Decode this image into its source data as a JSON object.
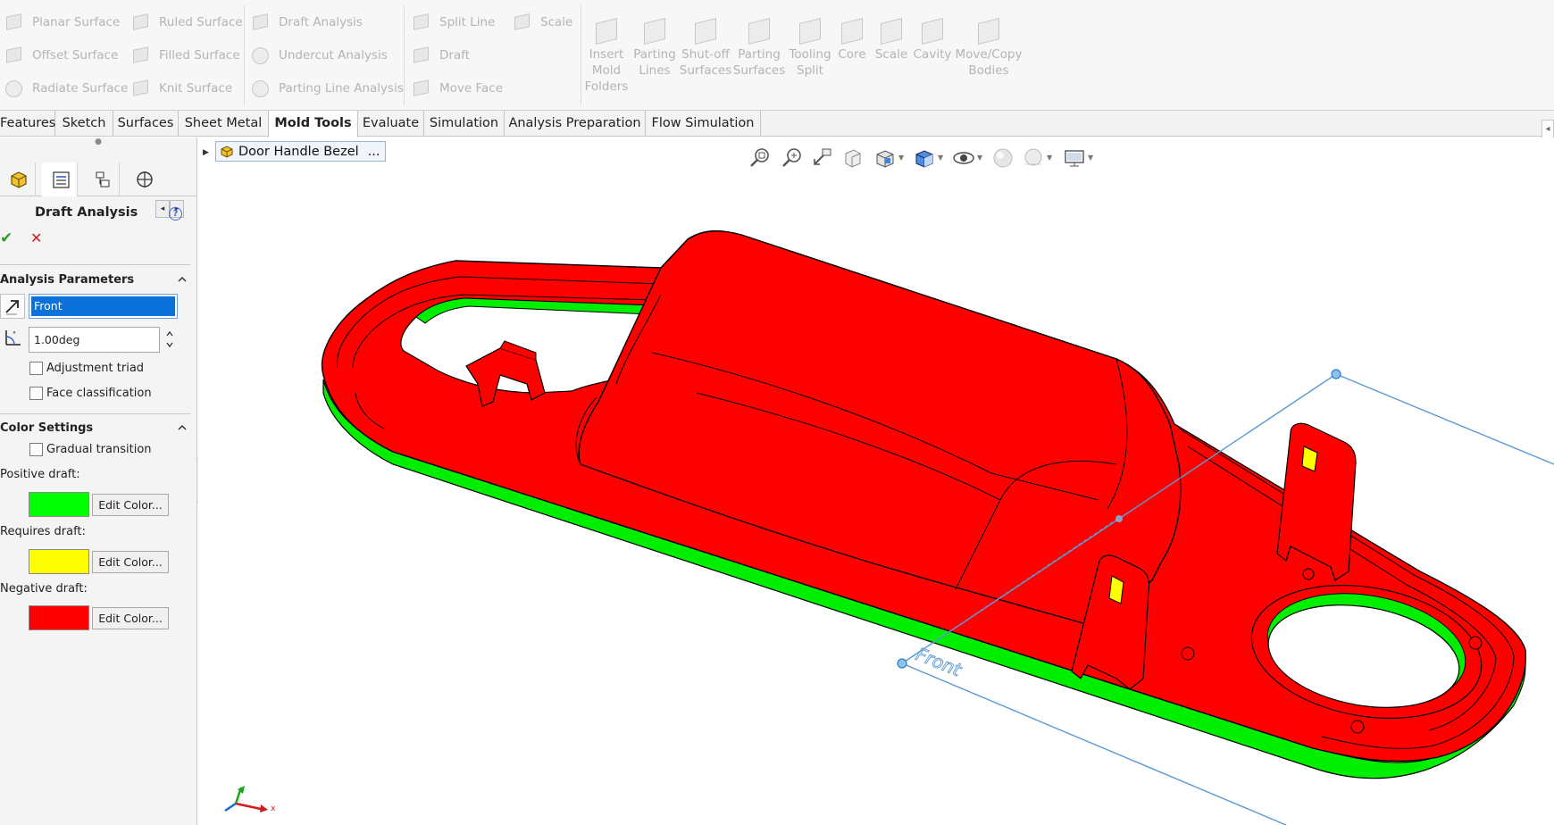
{
  "ribbon": {
    "surfaces": [
      "Planar Surface",
      "Offset Surface",
      "Radiate Surface"
    ],
    "surfaces2": [
      "Ruled Surface",
      "Filled Surface",
      "Knit Surface"
    ],
    "analysis": [
      "Draft Analysis",
      "Undercut Analysis",
      "Parting Line Analysis"
    ],
    "faces": [
      "Split Line",
      "Draft",
      "Move Face"
    ],
    "scale_small": "Scale",
    "big": [
      {
        "label": "Insert\nMold\nFolders",
        "icon": "insert-mold-folders-icon"
      },
      {
        "label": "Parting\nLines",
        "icon": "parting-lines-icon"
      },
      {
        "label": "Shut-off\nSurfaces",
        "icon": "shut-off-surfaces-icon"
      },
      {
        "label": "Parting\nSurfaces",
        "icon": "parting-surfaces-icon"
      },
      {
        "label": "Tooling\nSplit",
        "icon": "tooling-split-icon"
      },
      {
        "label": "Core",
        "icon": "core-icon"
      },
      {
        "label": "Scale",
        "icon": "scale-icon"
      },
      {
        "label": "Cavity",
        "icon": "cavity-icon"
      },
      {
        "label": "Move/Copy\nBodies",
        "icon": "move-copy-bodies-icon"
      }
    ]
  },
  "tabs": [
    "Features",
    "Sketch",
    "Surfaces",
    "Sheet Metal",
    "Mold Tools",
    "Evaluate",
    "Simulation",
    "Analysis Preparation",
    "Flow Simulation"
  ],
  "active_tab": "Mold Tools",
  "property_manager": {
    "title": "Draft Analysis",
    "analysis_parameters": {
      "header": "Analysis Parameters",
      "direction": "Front",
      "angle": "1.00deg",
      "adjustment_triad": "Adjustment triad",
      "face_classification": "Face classification"
    },
    "color_settings": {
      "header": "Color Settings",
      "gradual_transition": "Gradual transition",
      "positive_label": "Positive draft:",
      "requires_label": "Requires draft:",
      "negative_label": "Negative draft:",
      "edit_color": "Edit Color...",
      "positive_color": "#00ff00",
      "requires_color": "#ffff00",
      "negative_color": "#ff0000"
    }
  },
  "tree": {
    "part_name": "Door Handle Bezel",
    "ellipsis": "..."
  },
  "viewport": {
    "plane_label": "Front",
    "triad_x": "x"
  }
}
